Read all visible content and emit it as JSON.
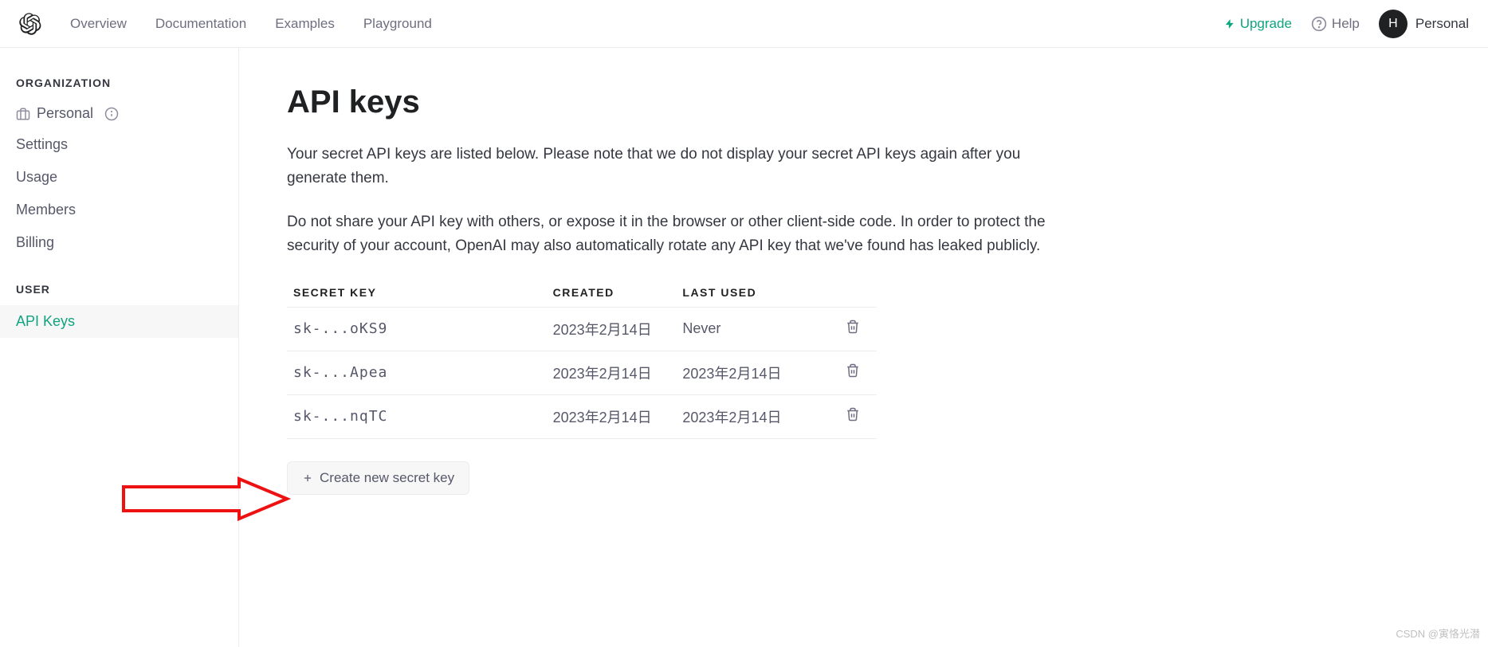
{
  "nav": {
    "links": [
      "Overview",
      "Documentation",
      "Examples",
      "Playground"
    ],
    "upgrade": "Upgrade",
    "help": "Help",
    "avatar_letter": "H",
    "avatar_name": "Personal"
  },
  "sidebar": {
    "org_label": "ORGANIZATION",
    "org_name": "Personal",
    "org_items": [
      "Settings",
      "Usage",
      "Members",
      "Billing"
    ],
    "user_label": "USER",
    "user_items": [
      {
        "label": "API Keys",
        "active": true
      }
    ]
  },
  "main": {
    "title": "API keys",
    "desc1": "Your secret API keys are listed below. Please note that we do not display your secret API keys again after you generate them.",
    "desc2": "Do not share your API key with others, or expose it in the browser or other client-side code. In order to protect the security of your account, OpenAI may also automatically rotate any API key that we've found has leaked publicly.",
    "table": {
      "headers": {
        "key": "SECRET KEY",
        "created": "CREATED",
        "used": "LAST USED"
      },
      "rows": [
        {
          "key": "sk-...oKS9",
          "created": "2023年2月14日",
          "used": "Never"
        },
        {
          "key": "sk-...Apea",
          "created": "2023年2月14日",
          "used": "2023年2月14日"
        },
        {
          "key": "sk-...nqTC",
          "created": "2023年2月14日",
          "used": "2023年2月14日"
        }
      ]
    },
    "create_button": "Create new secret key"
  },
  "watermark": "CSDN @寅恪光潜"
}
